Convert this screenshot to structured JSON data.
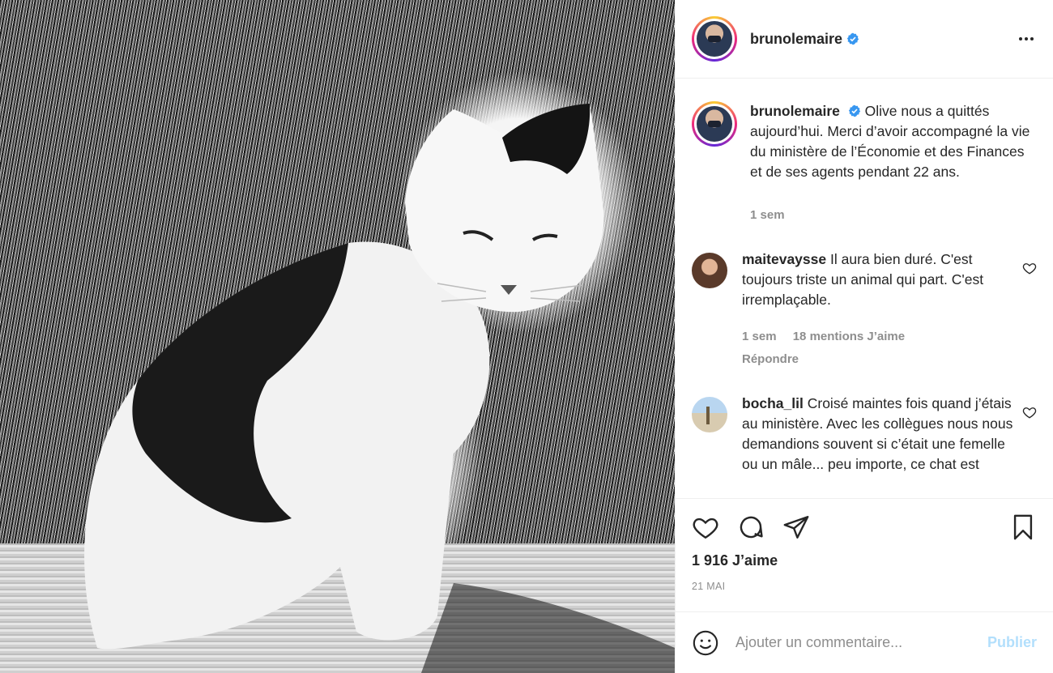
{
  "post": {
    "image_alt": "Black and white photo of a cat sitting in front of grass"
  },
  "header": {
    "username": "brunolemaire",
    "verified": true
  },
  "caption": {
    "username": "brunolemaire",
    "text": "Olive nous a quittés aujourd’hui. Merci d’avoir accompagné la vie du ministère de l’Économie et des Finances et de ses agents pendant 22 ans.",
    "time": "1 sem"
  },
  "comments": [
    {
      "username": "maitevaysse",
      "text": "Il aura bien duré. C'est toujours triste un animal qui part. C'est irremplaçable.",
      "time": "1 sem",
      "likes": "18 mentions J’aime",
      "reply": "Répondre"
    },
    {
      "username": "bocha_lil",
      "text": "Croisé maintes fois quand j’étais au ministère. Avec les collègues nous nous demandions souvent si c’était une femelle ou un mâle... peu importe, ce chat est"
    }
  ],
  "engagement": {
    "likes": "1 916 J’aime",
    "date": "21 MAI"
  },
  "add_comment": {
    "placeholder": "Ajouter un commentaire...",
    "publish": "Publier"
  },
  "colors": {
    "accent_publish": "#b2dffc",
    "verified": "#3897f0",
    "muted_text": "#8e8e8e"
  }
}
